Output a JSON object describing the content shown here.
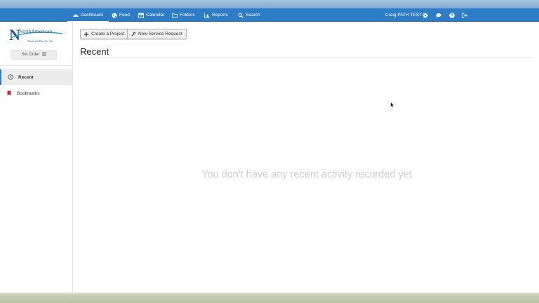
{
  "nav": {
    "items": [
      {
        "label": "Dashboard",
        "icon": "dashboard-icon"
      },
      {
        "label": "Feed",
        "icon": "globe-icon"
      },
      {
        "label": "Calendar",
        "icon": "calendar-icon"
      },
      {
        "label": "Folders",
        "icon": "folder-icon"
      },
      {
        "label": "Reports",
        "icon": "bar-chart-icon"
      },
      {
        "label": "Search",
        "icon": "search-icon"
      }
    ],
    "user_name": "Craig PATH TEST"
  },
  "logo": {
    "line1": "NorthAmerican",
    "line2": "Window & Door Co., Inc."
  },
  "sidebar": {
    "set_order_label": "Set Order",
    "items": [
      {
        "label": "Recent",
        "icon": "clock-icon"
      },
      {
        "label": "Bookmarks",
        "icon": "bookmark-icon"
      }
    ]
  },
  "main": {
    "buttons": {
      "create_project": "Create a Project",
      "new_service_request": "New Service Request"
    },
    "title": "Recent",
    "empty_message": "You don't have any recent activity recorded yet"
  },
  "colors": {
    "navbar": "#2d7cc6",
    "bookmark": "#d0262d"
  }
}
